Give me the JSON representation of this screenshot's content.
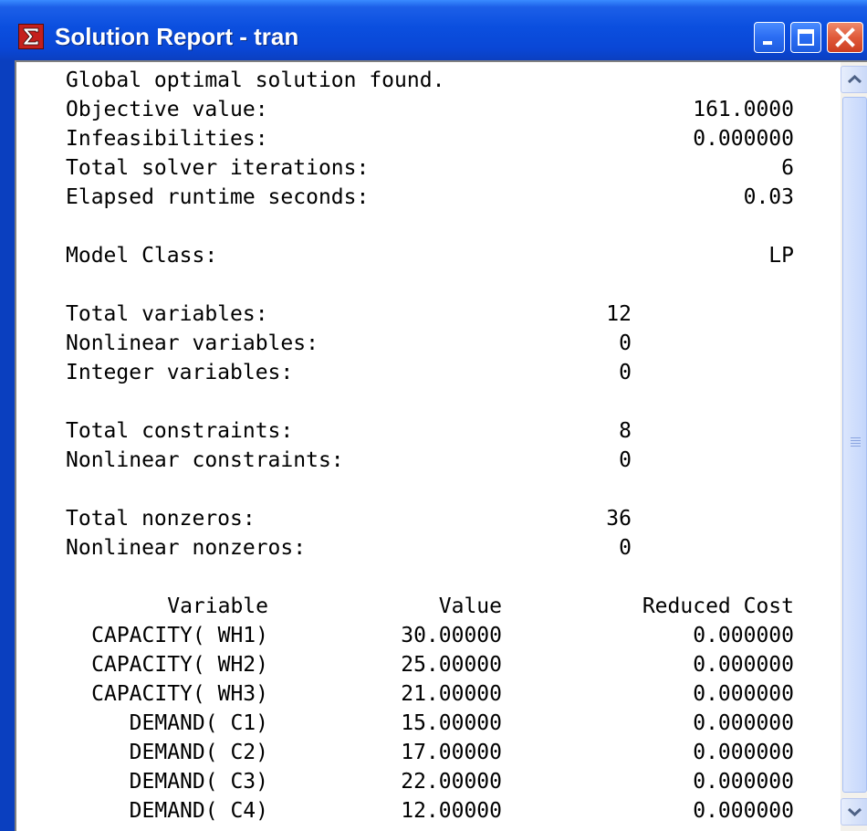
{
  "window": {
    "title": "Solution Report - tran",
    "icon": "lingo-sigma-icon",
    "buttons": [
      "minimize",
      "maximize",
      "close"
    ]
  },
  "summary": {
    "status": "Global optimal solution found.",
    "objective_label": "Objective value:",
    "objective_value": "161.0000",
    "infeasibilities_label": "Infeasibilities:",
    "infeasibilities_value": "0.000000",
    "iterations_label": "Total solver iterations:",
    "iterations_value": "6",
    "runtime_label": "Elapsed runtime seconds:",
    "runtime_value": "0.03",
    "model_class_label": "Model Class:",
    "model_class_value": "LP"
  },
  "stats": {
    "total_variables_label": "Total variables:",
    "total_variables": "12",
    "nonlinear_variables_label": "Nonlinear variables:",
    "nonlinear_variables": "0",
    "integer_variables_label": "Integer variables:",
    "integer_variables": "0",
    "total_constraints_label": "Total constraints:",
    "total_constraints": "8",
    "nonlinear_constraints_label": "Nonlinear constraints:",
    "nonlinear_constraints": "0",
    "total_nonzeros_label": "Total nonzeros:",
    "total_nonzeros": "36",
    "nonlinear_nonzeros_label": "Nonlinear nonzeros:",
    "nonlinear_nonzeros": "0"
  },
  "table": {
    "headers": [
      "Variable",
      "Value",
      "Reduced Cost"
    ],
    "rows": [
      {
        "variable": "CAPACITY( WH1)",
        "value": "30.00000",
        "reduced_cost": "0.000000"
      },
      {
        "variable": "CAPACITY( WH2)",
        "value": "25.00000",
        "reduced_cost": "0.000000"
      },
      {
        "variable": "CAPACITY( WH3)",
        "value": "21.00000",
        "reduced_cost": "0.000000"
      },
      {
        "variable": "DEMAND( C1)",
        "value": "15.00000",
        "reduced_cost": "0.000000"
      },
      {
        "variable": "DEMAND( C2)",
        "value": "17.00000",
        "reduced_cost": "0.000000"
      },
      {
        "variable": "DEMAND( C3)",
        "value": "22.00000",
        "reduced_cost": "0.000000"
      },
      {
        "variable": "DEMAND( C4)",
        "value": "12.00000",
        "reduced_cost": "0.000000"
      }
    ]
  }
}
